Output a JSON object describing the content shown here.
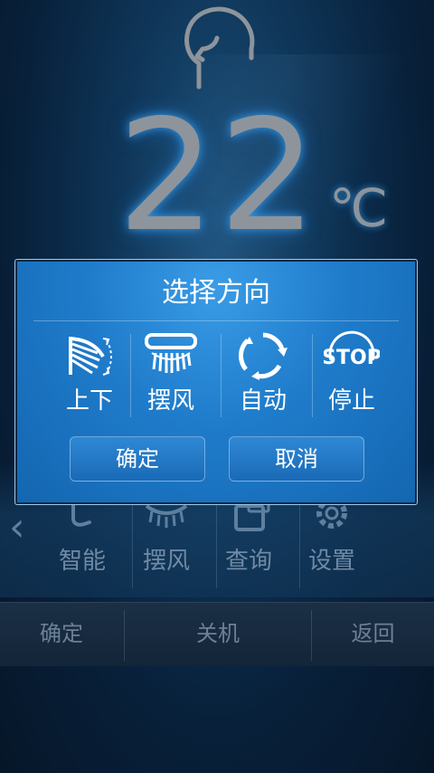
{
  "temperature": {
    "value": "22",
    "unit": "℃",
    "person_icon": "person-head-icon"
  },
  "menu": {
    "items": [
      {
        "label": "智能",
        "icon": "smart-icon"
      },
      {
        "label": "摆风",
        "icon": "swing-icon"
      },
      {
        "label": "查询",
        "icon": "query-icon"
      },
      {
        "label": "设置",
        "icon": "gear-icon"
      }
    ],
    "left_arrow": "‹"
  },
  "bottom_bar": {
    "confirm": "确定",
    "power_off": "关机",
    "back": "返回"
  },
  "dialog": {
    "title": "选择方向",
    "options": [
      {
        "label": "上下",
        "icon": "vertical-swing-icon"
      },
      {
        "label": "摆风",
        "icon": "horizontal-swing-icon"
      },
      {
        "label": "自动",
        "icon": "auto-cycle-icon"
      },
      {
        "label": "停止",
        "icon": "stop-icon",
        "icon_text": "STOP"
      }
    ],
    "confirm_button": "确定",
    "cancel_button": "取消"
  },
  "colors": {
    "dialog_blue": "#1f7ccb",
    "background_navy": "#061628",
    "temperature_glow": "#3caaff"
  }
}
